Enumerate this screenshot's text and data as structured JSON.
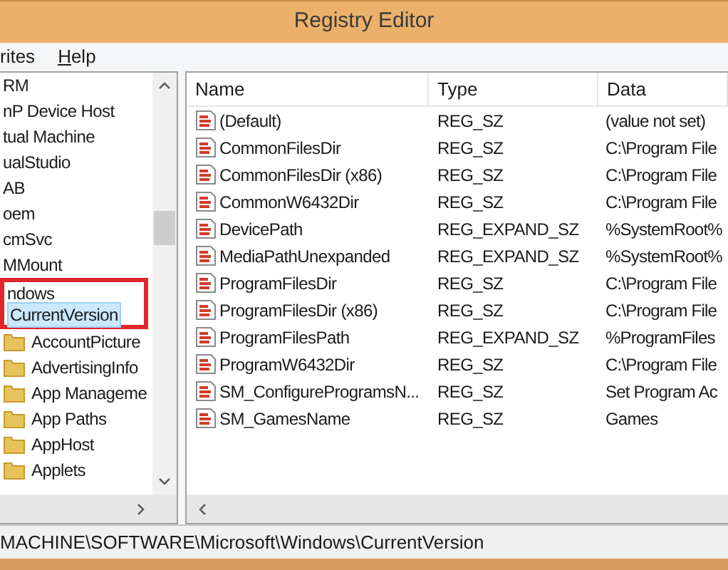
{
  "window": {
    "title": "Registry Editor"
  },
  "menu": [
    {
      "label": "rites",
      "mnemonic": false
    },
    {
      "label": "Help",
      "mnemonic": true
    }
  ],
  "tree": {
    "items": [
      {
        "label": "RM",
        "selected": false,
        "framed": false
      },
      {
        "label": "nP Device Host",
        "selected": false,
        "framed": false
      },
      {
        "label": "tual Machine",
        "selected": false,
        "framed": false
      },
      {
        "label": "ualStudio",
        "selected": false,
        "framed": false
      },
      {
        "label": "AB",
        "selected": false,
        "framed": false
      },
      {
        "label": "oem",
        "selected": false,
        "framed": false
      },
      {
        "label": "cmSvc",
        "selected": false,
        "framed": false
      },
      {
        "label": "MMount",
        "selected": false,
        "framed": false
      },
      {
        "label": "ndows",
        "selected": false,
        "framed": true,
        "children": [
          {
            "label": "CurrentVersion",
            "selected": true,
            "framed": true,
            "children": [
              {
                "label": "AccountPicture",
                "selected": false,
                "framed": false
              },
              {
                "label": "AdvertisingInfo",
                "selected": false,
                "framed": false
              },
              {
                "label": "App Manageme",
                "selected": false,
                "framed": false
              },
              {
                "label": "App Paths",
                "selected": false,
                "framed": false
              },
              {
                "label": "AppHost",
                "selected": false,
                "framed": false
              },
              {
                "label": "Applets",
                "selected": false,
                "framed": false
              }
            ]
          }
        ]
      }
    ]
  },
  "table": {
    "columns": [
      "Name",
      "Type",
      "Data"
    ],
    "rows": [
      {
        "name": "(Default)",
        "type": "REG_SZ",
        "data": "(value not set)"
      },
      {
        "name": "CommonFilesDir",
        "type": "REG_SZ",
        "data": "C:\\Program File"
      },
      {
        "name": "CommonFilesDir (x86)",
        "type": "REG_SZ",
        "data": "C:\\Program File"
      },
      {
        "name": "CommonW6432Dir",
        "type": "REG_SZ",
        "data": "C:\\Program File"
      },
      {
        "name": "DevicePath",
        "type": "REG_EXPAND_SZ",
        "data": "%SystemRoot%"
      },
      {
        "name": "MediaPathUnexpanded",
        "type": "REG_EXPAND_SZ",
        "data": "%SystemRoot%"
      },
      {
        "name": "ProgramFilesDir",
        "type": "REG_SZ",
        "data": "C:\\Program File"
      },
      {
        "name": "ProgramFilesDir (x86)",
        "type": "REG_SZ",
        "data": "C:\\Program File"
      },
      {
        "name": "ProgramFilesPath",
        "type": "REG_EXPAND_SZ",
        "data": "%ProgramFiles"
      },
      {
        "name": "ProgramW6432Dir",
        "type": "REG_SZ",
        "data": "C:\\Program File"
      },
      {
        "name": "SM_ConfigureProgramsN...",
        "type": "REG_SZ",
        "data": "Set Program Ac"
      },
      {
        "name": "SM_GamesName",
        "type": "REG_SZ",
        "data": "Games"
      }
    ]
  },
  "status_bar": {
    "path": "MACHINE\\SOFTWARE\\Microsoft\\Windows\\CurrentVersion"
  }
}
